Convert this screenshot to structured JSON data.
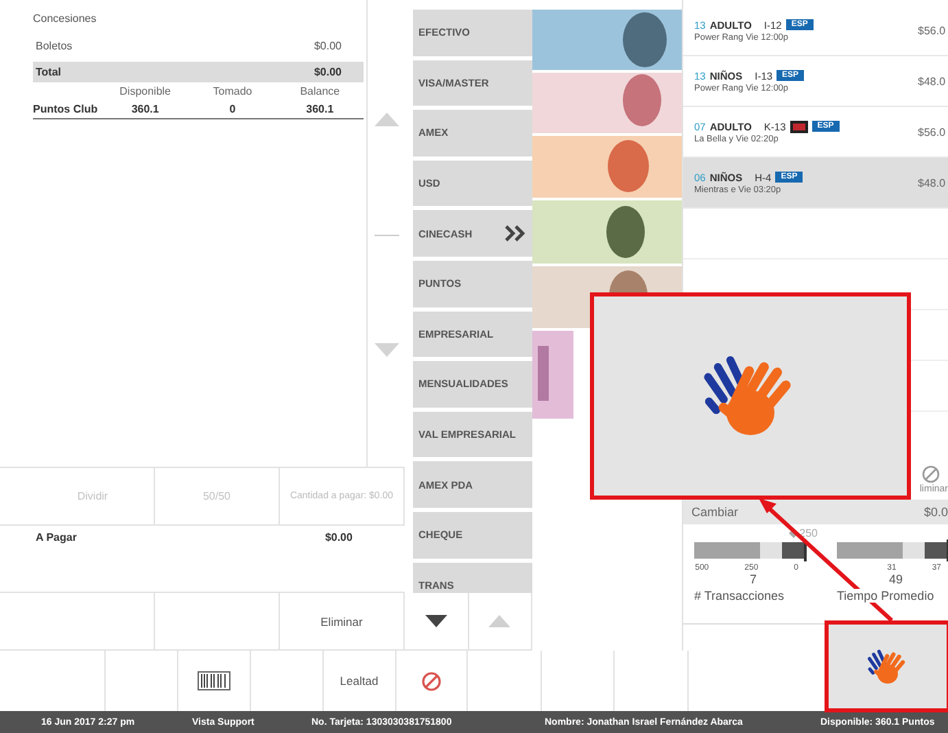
{
  "summary": {
    "title": "Concesiones",
    "lines": [
      {
        "label": "Boletos",
        "amount": "$0.00",
        "kind": "plain"
      },
      {
        "label": "Total",
        "amount": "$0.00",
        "kind": "total"
      }
    ],
    "points": {
      "columns": [
        "Disponible",
        "Tomado",
        "Balance"
      ],
      "rows": [
        {
          "label": "Puntos Club",
          "values": [
            "360.1",
            "0",
            "360.1"
          ]
        }
      ]
    }
  },
  "payment_methods": [
    {
      "label": "EFECTIVO",
      "expand": false
    },
    {
      "label": "VISA/MASTER",
      "expand": false
    },
    {
      "label": "AMEX",
      "expand": false
    },
    {
      "label": "USD",
      "expand": false
    },
    {
      "label": "CINECASH",
      "expand": true
    },
    {
      "label": "PUNTOS",
      "expand": false
    },
    {
      "label": "EMPRESARIAL",
      "expand": false
    },
    {
      "label": "MENSUALIDADES",
      "expand": false
    },
    {
      "label": "VAL EMPRESARIAL",
      "expand": false
    },
    {
      "label": "AMEX PDA",
      "expand": false
    },
    {
      "label": "CHEQUE",
      "expand": false
    },
    {
      "label": "TRANS",
      "expand": false
    }
  ],
  "split": {
    "buttons": [
      {
        "label": "Dividir",
        "disabled": true
      },
      {
        "label": "50/50",
        "disabled": true
      }
    ],
    "amount_label": "Cantidad a pagar: $0.00"
  },
  "to_pay": {
    "label": "A Pagar",
    "amount": "$0.00"
  },
  "delete_label": "Eliminar",
  "toolbar": [
    {
      "kind": "empty"
    },
    {
      "kind": "empty"
    },
    {
      "kind": "barcode"
    },
    {
      "kind": "empty"
    },
    {
      "kind": "text",
      "label": "Lealtad"
    },
    {
      "kind": "cancel"
    },
    {
      "kind": "empty"
    },
    {
      "kind": "empty"
    },
    {
      "kind": "empty"
    }
  ],
  "tickets": [
    {
      "seat": "13",
      "type": "ADULTO",
      "row": "I-12",
      "rated": false,
      "language": "ESP",
      "show": "Power Rang Vie 12:00p",
      "price": "$56.0",
      "selected": false
    },
    {
      "seat": "13",
      "type": "NIÑOS",
      "row": "I-13",
      "rated": false,
      "language": "ESP",
      "show": "Power Rang Vie 12:00p",
      "price": "$48.0",
      "selected": false
    },
    {
      "seat": "07",
      "type": "ADULTO",
      "row": "K-13",
      "rated": true,
      "language": "ESP",
      "show": "La Bella y Vie 02:20p",
      "price": "$56.0",
      "selected": false
    },
    {
      "seat": "06",
      "type": "NIÑOS",
      "row": "H-4",
      "rated": false,
      "language": "ESP",
      "show": "Mientras e Vie 03:20p",
      "price": "$48.0",
      "selected": true
    }
  ],
  "remove_label": "liminar",
  "change": {
    "label": "Cambiar",
    "amount": "$0.0"
  },
  "gauges": [
    {
      "marker": "250",
      "ticks": [
        "500",
        "250",
        "0"
      ],
      "value": "7",
      "title": "# Transacciones"
    },
    {
      "ticks": [
        "31",
        "37"
      ],
      "value": "49",
      "title": "Tiempo Promedio"
    }
  ],
  "status_bar": [
    "16 Jun 2017 2:27 pm",
    "Vista Support",
    "No. Tarjeta: 1303030381751800",
    "Nombre: Jonathan Israel Fernández Abarca",
    "Disponible: 360.1 Puntos"
  ]
}
